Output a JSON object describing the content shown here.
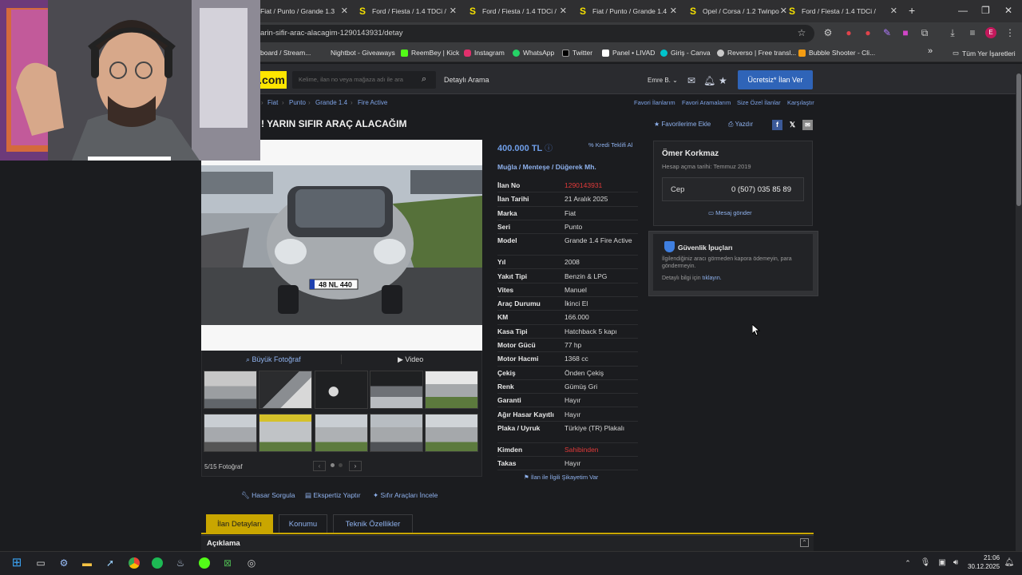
{
  "browser": {
    "tabs": [
      {
        "label": "Fiat / Punto / Grande 1.3",
        "icon": "sahibinden-icon"
      },
      {
        "label": "Ford / Fiesta / 1.4 TDCi /",
        "icon": "sahibinden-icon"
      },
      {
        "label": "Ford / Fiesta / 1.4 TDCi /",
        "icon": "sahibinden-icon"
      },
      {
        "label": "Fiat / Punto / Grande 1.4",
        "icon": "sahibinden-icon"
      },
      {
        "label": "Opel / Corsa / 1.2 Twinpo",
        "icon": "sahibinden-icon"
      },
      {
        "label": "Ford / Fiesta / 1.4 TDCi /",
        "icon": "sahibinden-icon"
      }
    ],
    "new_tab": "+",
    "url": "arin-sifir-arac-alacagim-1290143931/detay",
    "bookmarks": [
      "board / Stream...",
      "Nightbot - Giveaways",
      "ReemBey | Kick",
      "Instagram",
      "WhatsApp",
      "Twitter",
      "Panel • LIVAD",
      "Giriş - Canva",
      "Reverso | Free transl...",
      "Bubble Shooter - Cli..."
    ],
    "all_bookmarks": "Tüm Yer İşaretleri",
    "overflow": "»"
  },
  "site": {
    "logo": ".com",
    "search_placeholder": "Kelime, ilan no veya mağaza adı ile ara",
    "detailed_search": "Detaylı Arama",
    "user": "Emre B.",
    "post_ad": "Ücretsiz* İlan Ver",
    "breadcrumbs": [
      "Fiat",
      "Punto",
      "Grande 1.4",
      "Fire Active"
    ],
    "top_links": [
      "Favori İlanlarım",
      "Favori Aramalarım",
      "Size Özel İlanlar",
      "Karşılaştır"
    ]
  },
  "listing": {
    "title": "! YARIN SIFIR ARAÇ ALACAĞIM",
    "add_favorite": "Favorilerime Ekle",
    "print": "Yazdır",
    "price": "400.000 TL",
    "credit_offer": "Kredi Teklifi Al",
    "location": "Muğla  /  Menteşe  /  Düğerek Mh.",
    "details": [
      {
        "k": "İlan No",
        "v": "1290143931",
        "red": true
      },
      {
        "k": "İlan Tarihi",
        "v": "21 Aralık 2025"
      },
      {
        "k": "Marka",
        "v": "Fiat"
      },
      {
        "k": "Seri",
        "v": "Punto"
      },
      {
        "k": "Model",
        "v": "Grande 1.4 Fire Active"
      },
      {
        "k": "Yıl",
        "v": "2008"
      },
      {
        "k": "Yakıt Tipi",
        "v": "Benzin & LPG"
      },
      {
        "k": "Vites",
        "v": "Manuel"
      },
      {
        "k": "Araç Durumu",
        "v": "İkinci El"
      },
      {
        "k": "KM",
        "v": "166.000"
      },
      {
        "k": "Kasa Tipi",
        "v": "Hatchback 5 kapı"
      },
      {
        "k": "Motor Gücü",
        "v": "77 hp"
      },
      {
        "k": "Motor Hacmi",
        "v": "1368 cc"
      },
      {
        "k": "Çekiş",
        "v": "Önden Çekiş"
      },
      {
        "k": "Renk",
        "v": "Gümüş Gri"
      },
      {
        "k": "Garanti",
        "v": "Hayır"
      },
      {
        "k": "Ağır Hasar Kayıtlı",
        "v": "Hayır"
      },
      {
        "k": "Plaka / Uyruk",
        "v": "Türkiye (TR) Plakalı"
      },
      {
        "k": "Kimden",
        "v": "Sahibinden",
        "red": true
      },
      {
        "k": "Takas",
        "v": "Hayır"
      }
    ],
    "complaint": "İlan ile İlgili Şikayetim Var",
    "big_photo": "Büyük Fotoğraf",
    "video": "Video",
    "photo_counter": "5/15 Fotoğraf",
    "plate": "48 NL 440",
    "tools": [
      "Hasar Sorgula",
      "Ekspertiz Yaptır",
      "Sıfır Araçları İncele"
    ],
    "tabs": [
      "İlan Detayları",
      "Konumu",
      "Teknik Özellikler"
    ],
    "description_title": "Açıklama"
  },
  "seller": {
    "name": "Ömer Korkmaz",
    "since": "Hesap açma tarihi: Temmuz 2019",
    "phone_label": "Cep",
    "phone": "0 (507) 035 85 89",
    "message": "Mesaj gönder"
  },
  "safety": {
    "title": "Güvenlik İpuçları",
    "text": "İlgilendiğiniz aracı görmeden kapora ödemeyin, para göndermeyin.",
    "detail_prefix": "Detaylı bilgi için ",
    "detail_link": "tıklayın."
  },
  "taskbar": {
    "time": "21:06",
    "date": "30.12.2025"
  },
  "colors": {
    "accent_yellow": "#ffe600",
    "link_blue": "#8fb2ee",
    "post_button": "#2f64b8",
    "active_tab": "#c9a600",
    "warning_red": "#e23a3a"
  }
}
